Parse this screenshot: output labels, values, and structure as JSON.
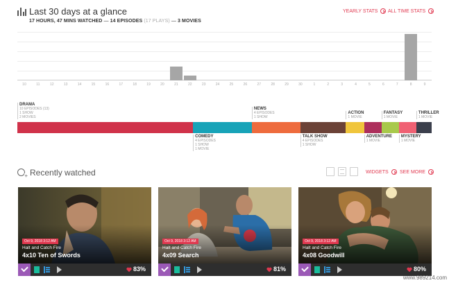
{
  "header": {
    "icon": "bar-chart-icon",
    "title": "Last 30 days at a glance",
    "stats": {
      "hours": "17 HOURS, 47 MINS WATCHED",
      "sep1": "—",
      "episodes": "14 EPISODES",
      "plays": "(17 PLAYS)",
      "sep2": "—",
      "movies": "3 MOVIES"
    },
    "yearly_label": "YEARLY STATS",
    "alltime_label": "ALL TIME STATS"
  },
  "chart_data": {
    "type": "bar",
    "categories": [
      "10",
      "11",
      "12",
      "13",
      "14",
      "15",
      "16",
      "17",
      "18",
      "19",
      "20",
      "21",
      "22",
      "23",
      "24",
      "25",
      "26",
      "27",
      "28",
      "29",
      "30",
      "1",
      "2",
      "3",
      "4",
      "5",
      "6",
      "7",
      "8",
      "9"
    ],
    "values": [
      0,
      0,
      0,
      0,
      0,
      0,
      0,
      0,
      0,
      0,
      0,
      3,
      1,
      0,
      0,
      0,
      0,
      0,
      0,
      0,
      0,
      0,
      0,
      0,
      0,
      0,
      0,
      0,
      10,
      0
    ],
    "ylim": [
      0,
      10.5
    ],
    "grid": true,
    "bar_color": "#a6a6a6"
  },
  "genres": [
    {
      "name": "DRAMA",
      "details": [
        "10 EPISODES (13)",
        "1 SHOW",
        "2 MOVIES"
      ],
      "share": 0.424,
      "color": "#d0324a",
      "label_pos": "top"
    },
    {
      "name": "COMEDY",
      "details": [
        "4 EPISODES",
        "1 SHOW",
        "1 MOVIE"
      ],
      "share": 0.142,
      "color": "#17a3b8",
      "label_pos": "bottom"
    },
    {
      "name": "NEWS",
      "details": [
        "4 EPISODES",
        "1 SHOW"
      ],
      "share": 0.117,
      "color": "#ee6b3d",
      "label_pos": "top"
    },
    {
      "name": "TALK SHOW",
      "details": [
        "4 EPISODES",
        "1 SHOW"
      ],
      "share": 0.11,
      "color": "#6b4237",
      "label_pos": "bottom"
    },
    {
      "name": "ACTION",
      "details": [
        "1 MOVIE"
      ],
      "share": 0.044,
      "color": "#f0c53c",
      "label_pos": "top"
    },
    {
      "name": "ADVENTURE",
      "details": [
        "1 MOVIE"
      ],
      "share": 0.042,
      "color": "#ad2f5c",
      "label_pos": "bottom"
    },
    {
      "name": "FANTASY",
      "details": [
        "1 MOVIE"
      ],
      "share": 0.042,
      "color": "#a8c94b",
      "label_pos": "top"
    },
    {
      "name": "MYSTERY",
      "details": [
        "1 MOVIE"
      ],
      "share": 0.042,
      "color": "#f06173",
      "label_pos": "bottom"
    },
    {
      "name": "THRILLER",
      "details": [
        "1 MOVIE"
      ],
      "share": 0.037,
      "color": "#3b3f4c",
      "label_pos": "top"
    }
  ],
  "recent": {
    "icon": "history-icon",
    "title": "Recently watched",
    "widgets_label": "WIDGETS",
    "see_more_label": "SEE MORE",
    "cards": [
      {
        "date": "Oct 9, 2018 3:12 AM",
        "show": "Halt and Catch Fire",
        "episode": "4x10 Ten of Swords",
        "rating": "83%"
      },
      {
        "date": "Oct 9, 2018 3:12 AM",
        "show": "Halt and Catch Fire",
        "episode": "4x09 Search",
        "rating": "81%"
      },
      {
        "date": "Oct 9, 2018 3:12 AM",
        "show": "Halt and Catch Fire",
        "episode": "4x08 Goodwill",
        "rating": "80%"
      }
    ]
  },
  "colors": {
    "accent": "#e0384f",
    "checked": "#9b59b6",
    "doc": "#1abc9c",
    "list": "#3498db"
  },
  "watermark": "www.989214.com"
}
